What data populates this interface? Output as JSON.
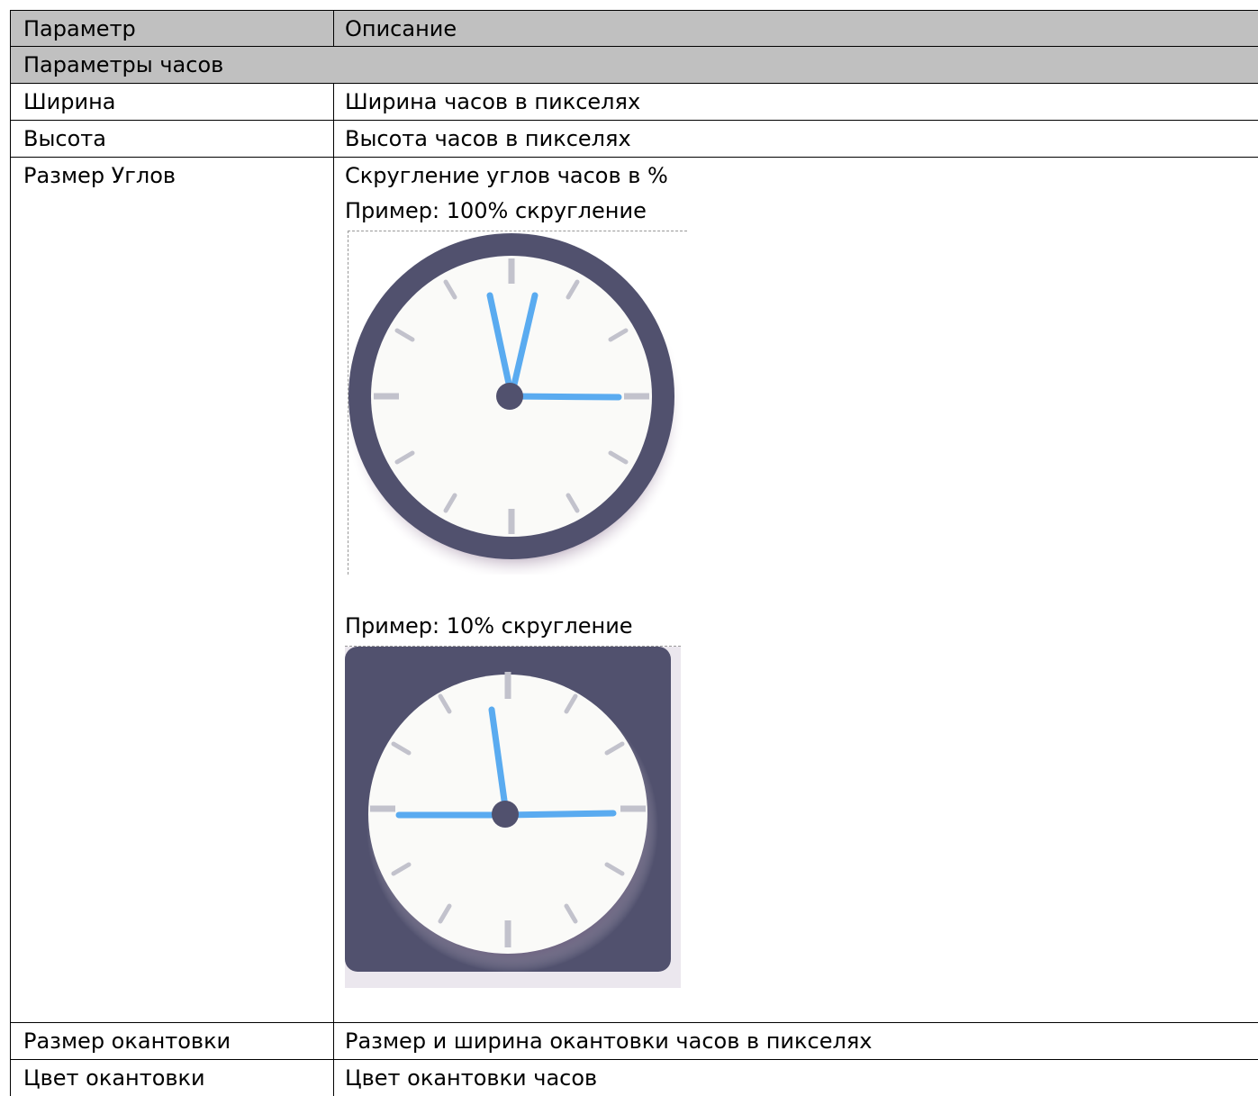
{
  "header": {
    "col1": "Параметр",
    "col2": "Описание"
  },
  "section": {
    "title": "Параметры часов"
  },
  "rows": [
    {
      "param": "Ширина",
      "desc": "Ширина часов в пикселях"
    },
    {
      "param": "Высота",
      "desc": "Высота часов в пикселях"
    },
    {
      "param": "Размер Углов",
      "desc": "Скругление углов часов в %",
      "example1": "Пример: 100% скругление",
      "example2": "Пример: 10% скругление"
    },
    {
      "param": "Размер окантовки",
      "desc": "Размер и ширина окантовки часов в пикселях"
    },
    {
      "param": "Цвет окантовки",
      "desc": "Цвет окантовки часов"
    }
  ],
  "colors": {
    "header_bg": "#c0c0c0",
    "clock_frame": "#51516e",
    "clock_face": "#fafaf8",
    "hands": "#5aabf0",
    "ticks": "#c2c2cc"
  },
  "icons": [
    "clock-round-icon",
    "clock-square-icon"
  ]
}
